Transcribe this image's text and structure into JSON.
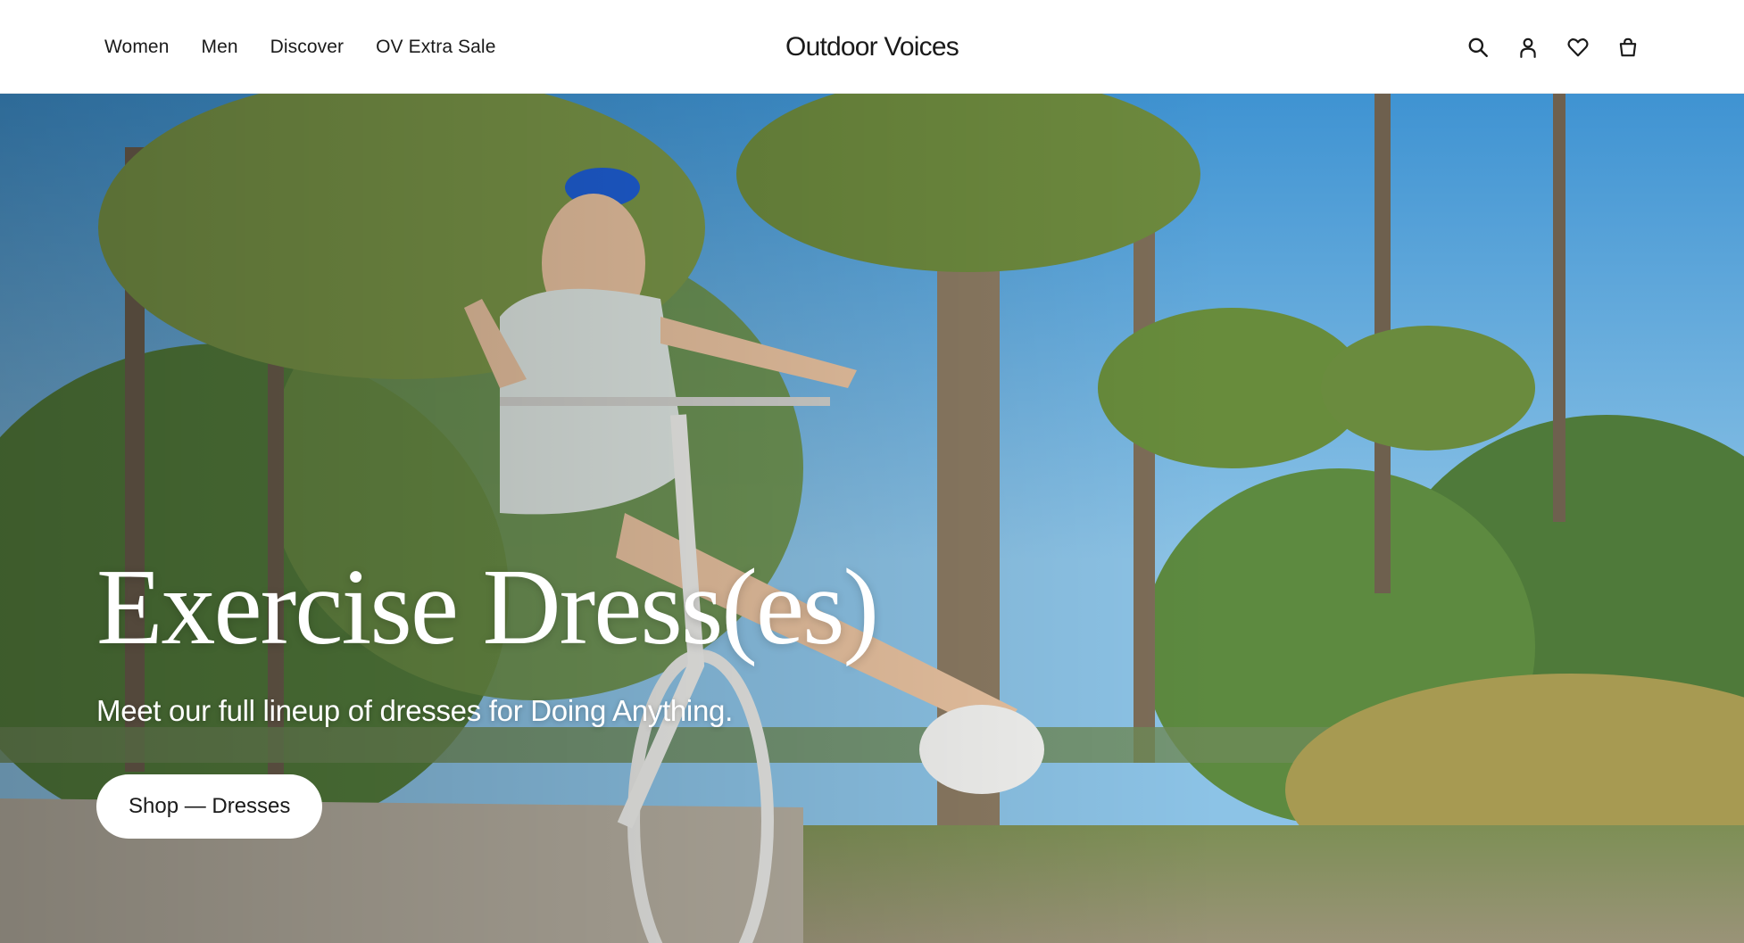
{
  "header": {
    "nav": [
      {
        "label": "Women"
      },
      {
        "label": "Men"
      },
      {
        "label": "Discover"
      },
      {
        "label": "OV Extra Sale"
      }
    ],
    "logo": "Outdoor Voices",
    "icons": [
      "search-icon",
      "account-icon",
      "heart-icon",
      "bag-icon"
    ]
  },
  "hero": {
    "title": "Exercise Dress(es)",
    "subtitle": "Meet our full lineup of dresses for Doing Anything.",
    "cta_label": "Shop — Dresses"
  },
  "colors": {
    "header_bg": "#ffffff",
    "text": "#1a1a1a",
    "hero_text": "#ffffff",
    "cta_bg": "#ffffff"
  }
}
